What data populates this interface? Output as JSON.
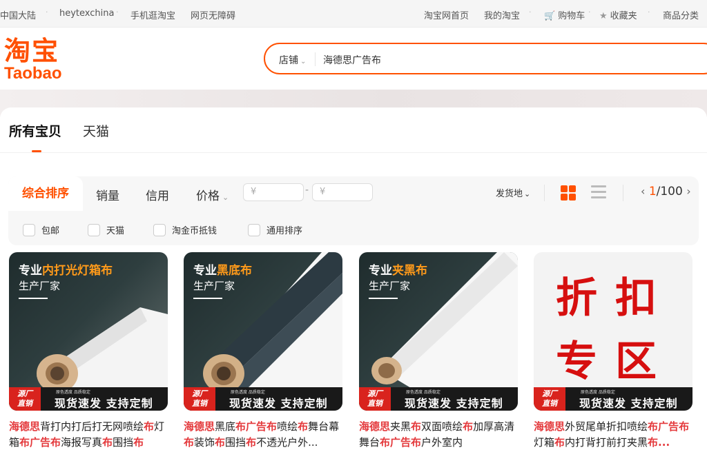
{
  "topbar": {
    "region": "中国大陆",
    "username": "heytexchina",
    "mobile": "手机逛淘宝",
    "accessibility": "网页无障碍",
    "home": "淘宝网首页",
    "my_taobao": "我的淘宝",
    "cart": "购物车",
    "favorites": "收藏夹",
    "categories": "商品分类"
  },
  "header": {
    "logo_cn": "淘宝",
    "logo_en": "Taobao",
    "search_scope": "店铺",
    "search_query": "海德思广告布"
  },
  "tabs": [
    "所有宝贝",
    "天猫"
  ],
  "sort": {
    "active": "综合排序",
    "sales": "销量",
    "credit": "信用",
    "price": "价格",
    "price_min_placeholder": "¥",
    "price_max_placeholder": "¥",
    "price_dash": "-",
    "ship_from": "发货地",
    "page_current": "1",
    "page_total": "/100"
  },
  "filters": [
    "包邮",
    "天猫",
    "淘金币抵钱",
    "通用排序"
  ],
  "colors": {
    "accent": "#ff5000",
    "price_red": "#e4393c"
  },
  "products": [
    {
      "headline_pre": "专业",
      "headline_hl": "内打光灯箱布",
      "subline": "生产厂家",
      "tag_l1": "源厂",
      "tag_l2": "直销",
      "mini": "原色透度 品质稳定",
      "slogan": "现货速发 支持定制",
      "title_parts": [
        {
          "t": "海德思",
          "r": true
        },
        {
          "t": "背打内打后打无网喷绘",
          "r": false
        },
        {
          "t": "布",
          "r": true
        },
        {
          "t": "灯箱",
          "r": false
        },
        {
          "t": "布",
          "r": true
        },
        {
          "t": "广告布",
          "r": true
        },
        {
          "t": "海报写真",
          "r": false
        },
        {
          "t": "布",
          "r": true
        },
        {
          "t": "围挡",
          "r": false
        },
        {
          "t": "布",
          "r": true
        }
      ]
    },
    {
      "headline_pre": "专业",
      "headline_hl": "黑底布",
      "subline": "生产厂家",
      "tag_l1": "源厂",
      "tag_l2": "直销",
      "mini": "原色透度 品质稳定",
      "slogan": "现货速发 支持定制",
      "title_parts": [
        {
          "t": "海德思",
          "r": true
        },
        {
          "t": "黑底",
          "r": false
        },
        {
          "t": "布",
          "r": true
        },
        {
          "t": "广告布",
          "r": true
        },
        {
          "t": "喷绘",
          "r": false
        },
        {
          "t": "布",
          "r": true
        },
        {
          "t": "舞台幕",
          "r": false
        },
        {
          "t": "布",
          "r": true
        },
        {
          "t": "装饰",
          "r": false
        },
        {
          "t": "布",
          "r": true
        },
        {
          "t": "围挡",
          "r": false
        },
        {
          "t": "布",
          "r": true
        },
        {
          "t": "不透光户外...",
          "r": false
        }
      ]
    },
    {
      "headline_pre": "专业",
      "headline_hl": "夹黑布",
      "subline": "生产厂家",
      "tag_l1": "源厂",
      "tag_l2": "直销",
      "mini": "原色透度 品质稳定",
      "slogan": "现货速发 支持定制",
      "title_parts": [
        {
          "t": "海德思",
          "r": true
        },
        {
          "t": "夹黑",
          "r": false
        },
        {
          "t": "布",
          "r": true
        },
        {
          "t": "双面喷绘",
          "r": false
        },
        {
          "t": "布",
          "r": true
        },
        {
          "t": "加厚高清舞台",
          "r": false
        },
        {
          "t": "布",
          "r": true
        },
        {
          "t": "广告布",
          "r": true
        },
        {
          "t": "户外室内",
          "r": false
        }
      ]
    },
    {
      "promo_line1": "折扣",
      "promo_line2": "专区",
      "tag_l1": "源厂",
      "tag_l2": "直销",
      "mini": "原色透度 品质稳定",
      "slogan": "现货速发 支持定制",
      "title_parts": [
        {
          "t": "海德思",
          "r": true
        },
        {
          "t": "外贸尾单折扣喷绘",
          "r": false
        },
        {
          "t": "布",
          "r": true
        },
        {
          "t": "广告",
          "r": true
        },
        {
          "t": "布",
          "r": true
        },
        {
          "t": "灯箱",
          "r": false
        },
        {
          "t": "布",
          "r": true
        },
        {
          "t": "内打背打前打夹黑",
          "r": false
        },
        {
          "t": "布...",
          "r": true
        }
      ]
    }
  ]
}
